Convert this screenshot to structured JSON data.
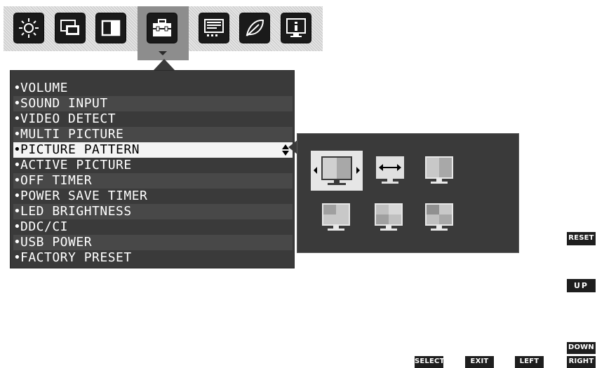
{
  "top_bar": {
    "tabs": [
      {
        "icon": "brightness-sun-icon",
        "active": false
      },
      {
        "icon": "screen-position-icon",
        "active": false
      },
      {
        "icon": "color-contrast-icon",
        "active": false
      },
      {
        "icon": "toolbox-icon",
        "active": true
      },
      {
        "icon": "osd-settings-icon",
        "active": false
      },
      {
        "icon": "eco-leaf-icon",
        "active": false
      },
      {
        "icon": "information-icon",
        "active": false
      }
    ]
  },
  "menu": {
    "items": [
      {
        "label": "VOLUME"
      },
      {
        "label": "SOUND INPUT"
      },
      {
        "label": "VIDEO DETECT"
      },
      {
        "label": "MULTI PICTURE"
      },
      {
        "label": "PICTURE PATTERN",
        "selected": true
      },
      {
        "label": "ACTIVE PICTURE"
      },
      {
        "label": "OFF TIMER"
      },
      {
        "label": "POWER SAVE TIMER"
      },
      {
        "label": "LED BRIGHTNESS"
      },
      {
        "label": "DDC/CI"
      },
      {
        "label": "USB POWER"
      },
      {
        "label": "FACTORY PRESET"
      }
    ],
    "bullet": "•"
  },
  "submenu": {
    "patterns": [
      {
        "icon": "pattern-left-right-split-icon",
        "selected": true
      },
      {
        "icon": "pattern-swap-arrows-icon",
        "selected": false
      },
      {
        "icon": "pattern-vertical-split-icon",
        "selected": false
      },
      {
        "icon": "pattern-pip-top-left-icon",
        "selected": false
      },
      {
        "icon": "pattern-pip-bottom-left-icon",
        "selected": false
      },
      {
        "icon": "pattern-quad-icon",
        "selected": false
      }
    ]
  },
  "buttons": {
    "reset": "RESET",
    "up": "UP",
    "down": "DOWN",
    "right": "RIGHT",
    "select": "SELECT",
    "exit": "EXIT",
    "left": "LEFT"
  },
  "colors": {
    "panel": "#3a3a3a",
    "selected_row": "#f4f4f4",
    "active_tab": "#8d8d8d",
    "button": "#1e1e1e"
  }
}
